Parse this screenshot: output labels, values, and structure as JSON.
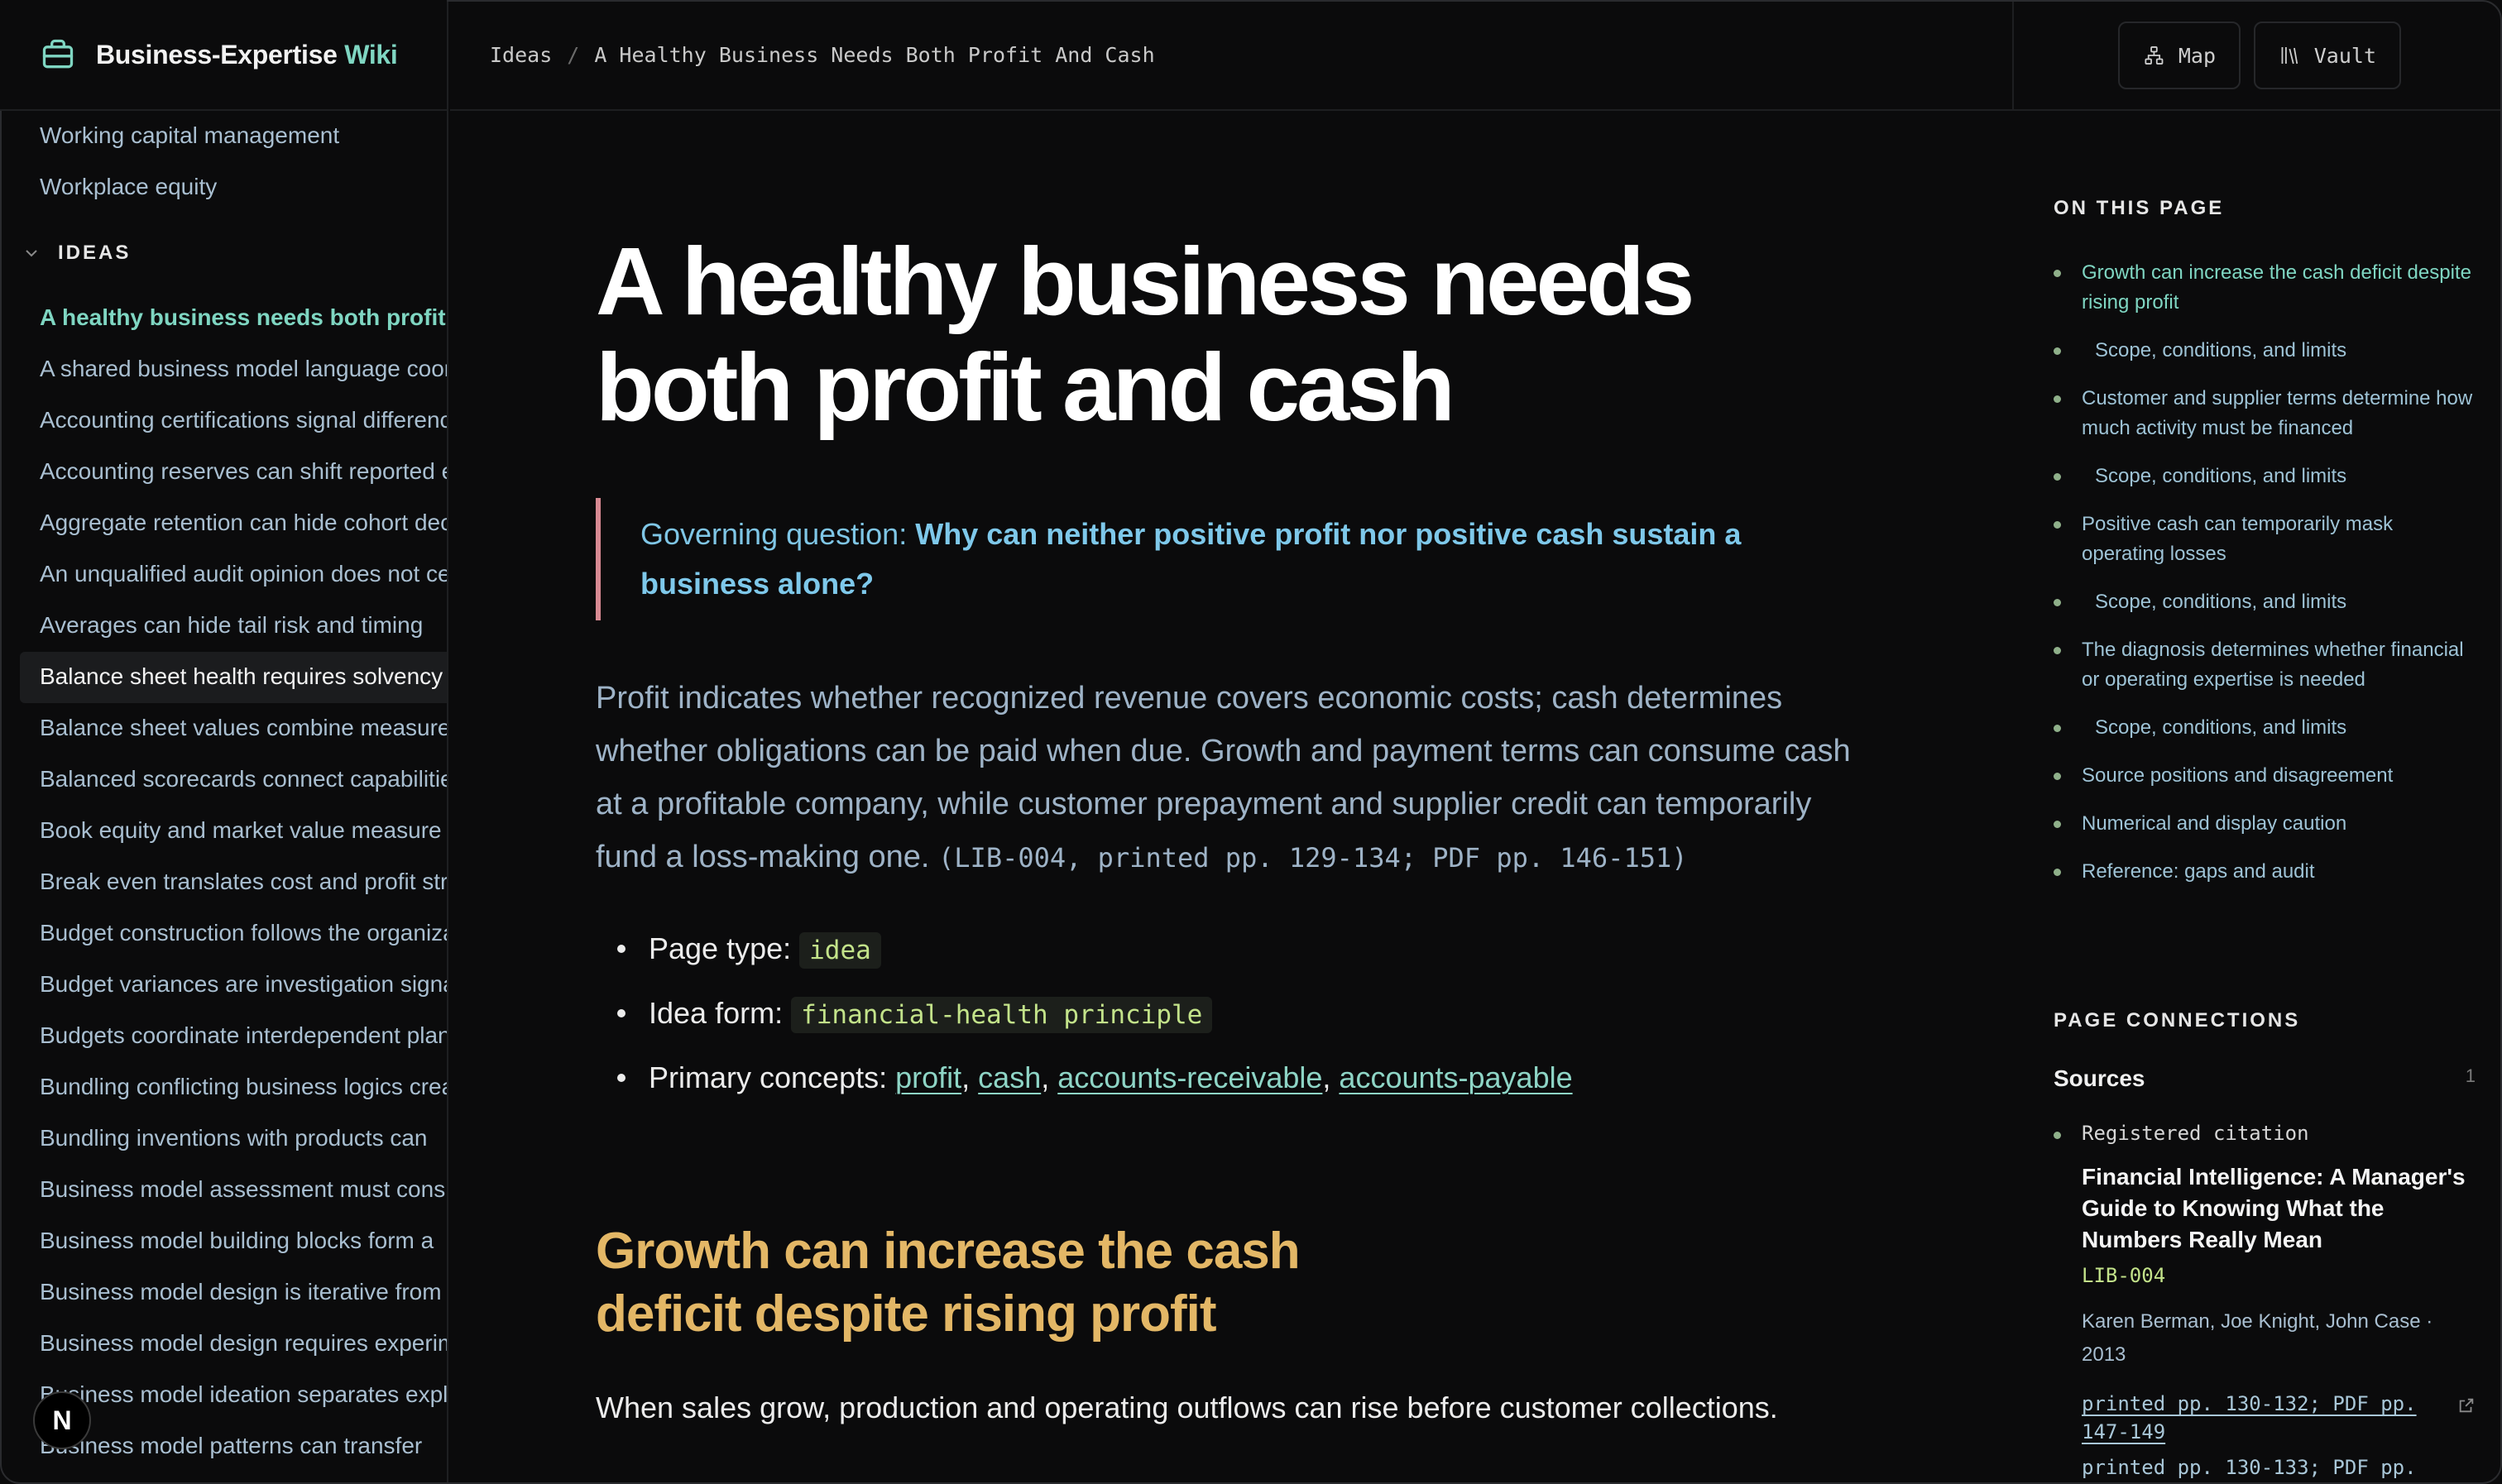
{
  "brand": {
    "name": "Business-Expertise",
    "accent": "Wiki",
    "icon": "briefcase-icon"
  },
  "sidebar": {
    "items_top": [
      "Working capital management",
      "Workplace equity"
    ],
    "section": "IDEAS",
    "items": [
      "A healthy business needs both profit and cash",
      "A shared business model language coordinates",
      "Accounting certifications signal differences",
      "Accounting reserves can shift reported earnings",
      "Aggregate retention can hide cohort decay",
      "An unqualified audit opinion does not certify",
      "Averages can hide tail risk and timing",
      "Balance sheet health requires solvency",
      "Balance sheet values combine measurement",
      "Balanced scorecards connect capabilities",
      "Book equity and market value measure",
      "Break even translates cost and profit structure",
      "Budget construction follows the organization",
      "Budget variances are investigation signals",
      "Budgets coordinate interdependent plans",
      "Bundling conflicting business logics creates",
      "Bundling inventions with products can",
      "Business model assessment must consider",
      "Business model building blocks form a",
      "Business model design is iterative from",
      "Business model design requires experimentation",
      "Business model ideation separates exploration",
      "Business model patterns can transfer"
    ],
    "active_index": 0,
    "hover_index": 7,
    "badge": "N"
  },
  "breadcrumb": {
    "root": "Ideas",
    "separator": "/",
    "current": "A Healthy Business Needs Both Profit And Cash"
  },
  "toolbar": {
    "map_label": "Map",
    "vault_label": "Vault"
  },
  "article": {
    "title": "A healthy business needs both profit and cash",
    "question_label": "Governing question:",
    "question": "Why can neither positive profit nor positive cash sustain a business alone?",
    "lead": "Profit indicates whether recognized revenue covers economic costs; cash determines whether obligations can be paid when due. Growth and payment terms can consume cash at a profitable company, while customer prepayment and supplier credit can temporarily fund a loss-making one.",
    "lead_cite": "(LIB-004, printed pp. 129-134; PDF pp. 146-151)",
    "page_type_label": "Page type:",
    "page_type": "idea",
    "idea_form_label": "Idea form:",
    "idea_form": "financial-health principle",
    "concepts_label": "Primary concepts:",
    "concepts": [
      "profit",
      "cash",
      "accounts-receivable",
      "accounts-payable"
    ],
    "h2": "Growth can increase the cash deficit despite rising profit",
    "para": "When sales grow, production and operating outflows can rise before customer collections."
  },
  "toc": {
    "title": "ON THIS PAGE",
    "items": [
      {
        "label": "Growth can increase the cash deficit despite rising profit",
        "sub": false
      },
      {
        "label": "Scope, conditions, and limits",
        "sub": true
      },
      {
        "label": "Customer and supplier terms determine how much activity must be financed",
        "sub": false
      },
      {
        "label": "Scope, conditions, and limits",
        "sub": true
      },
      {
        "label": "Positive cash can temporarily mask operating losses",
        "sub": false
      },
      {
        "label": "Scope, conditions, and limits",
        "sub": true
      },
      {
        "label": "The diagnosis determines whether financial or operating expertise is needed",
        "sub": false
      },
      {
        "label": "Scope, conditions, and limits",
        "sub": true
      },
      {
        "label": "Source positions and disagreement",
        "sub": false
      },
      {
        "label": "Numerical and display caution",
        "sub": false
      },
      {
        "label": "Reference: gaps and audit",
        "sub": false
      }
    ]
  },
  "connections": {
    "title": "PAGE CONNECTIONS",
    "sources_label": "Sources",
    "sources_count": "1",
    "source": {
      "kind": "Registered citation",
      "title": "Financial Intelligence: A Manager's Guide to Knowing What the Numbers Really Mean",
      "id": "LIB-004",
      "authors": "Karen Berman, Joe Knight, John Case · 2013",
      "pages": "printed pp. 130-132; PDF pp. 147-149",
      "pages2": "printed pp. 130-133; PDF pp."
    }
  },
  "colors": {
    "accent": "#7fd6c2",
    "heading2": "#e3b766",
    "question": "#7ec8ea",
    "code": "#c3e38a",
    "callout_border": "#d88a93"
  }
}
